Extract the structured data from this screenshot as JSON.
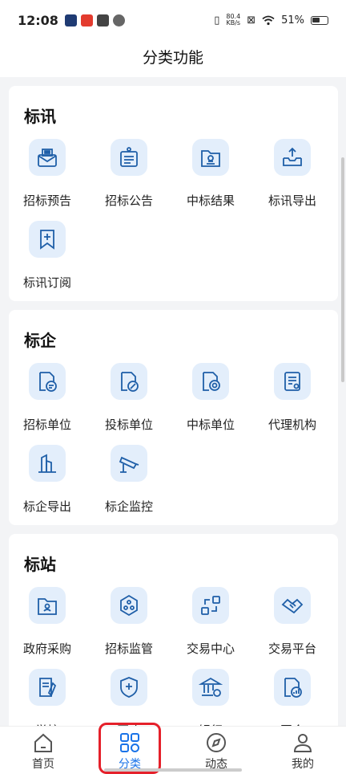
{
  "status_bar": {
    "time": "12:08",
    "net_speed_value": "80.4",
    "net_speed_unit": "KB/s",
    "battery": "51%",
    "icons": [
      "vibrate-icon",
      "sim-icon",
      "wifi-icon",
      "battery-icon"
    ]
  },
  "header": {
    "title": "分类功能"
  },
  "sections": [
    {
      "title": "标讯",
      "items": [
        {
          "label": "招标预告",
          "icon": "envelope-flag-icon"
        },
        {
          "label": "招标公告",
          "icon": "notice-board-icon"
        },
        {
          "label": "中标结果",
          "icon": "folder-stamp-icon"
        },
        {
          "label": "标讯导出",
          "icon": "tray-upload-icon"
        },
        {
          "label": "标讯订阅",
          "icon": "bookmark-plus-icon"
        }
      ]
    },
    {
      "title": "标企",
      "items": [
        {
          "label": "招标单位",
          "icon": "doc-chat-icon"
        },
        {
          "label": "投标单位",
          "icon": "doc-pen-icon"
        },
        {
          "label": "中标单位",
          "icon": "doc-medal-icon"
        },
        {
          "label": "代理机构",
          "icon": "doc-gear-icon"
        },
        {
          "label": "标企导出",
          "icon": "buildings-icon"
        },
        {
          "label": "标企监控",
          "icon": "camera-monitor-icon"
        }
      ]
    },
    {
      "title": "标站",
      "items": [
        {
          "label": "政府采购",
          "icon": "folder-person-icon"
        },
        {
          "label": "招标监管",
          "icon": "hexagon-nodes-icon"
        },
        {
          "label": "交易中心",
          "icon": "exchange-icon"
        },
        {
          "label": "交易平台",
          "icon": "handshake-icon"
        },
        {
          "label": "学校",
          "icon": "doc-pencil-icon"
        },
        {
          "label": "医疗",
          "icon": "shield-cross-icon"
        },
        {
          "label": "银行",
          "icon": "bank-icon"
        },
        {
          "label": "国企",
          "icon": "doc-chart-icon"
        }
      ]
    }
  ],
  "bottom_nav": [
    {
      "label": "首页",
      "icon": "home-icon",
      "active": false
    },
    {
      "label": "分类",
      "icon": "category-grid-icon",
      "active": true
    },
    {
      "label": "动态",
      "icon": "compass-icon",
      "active": false
    },
    {
      "label": "我的",
      "icon": "user-icon",
      "active": false
    }
  ],
  "colors": {
    "accent": "#1a73e8",
    "icon_bg": "#e3eefb",
    "highlight": "#e5202a"
  }
}
